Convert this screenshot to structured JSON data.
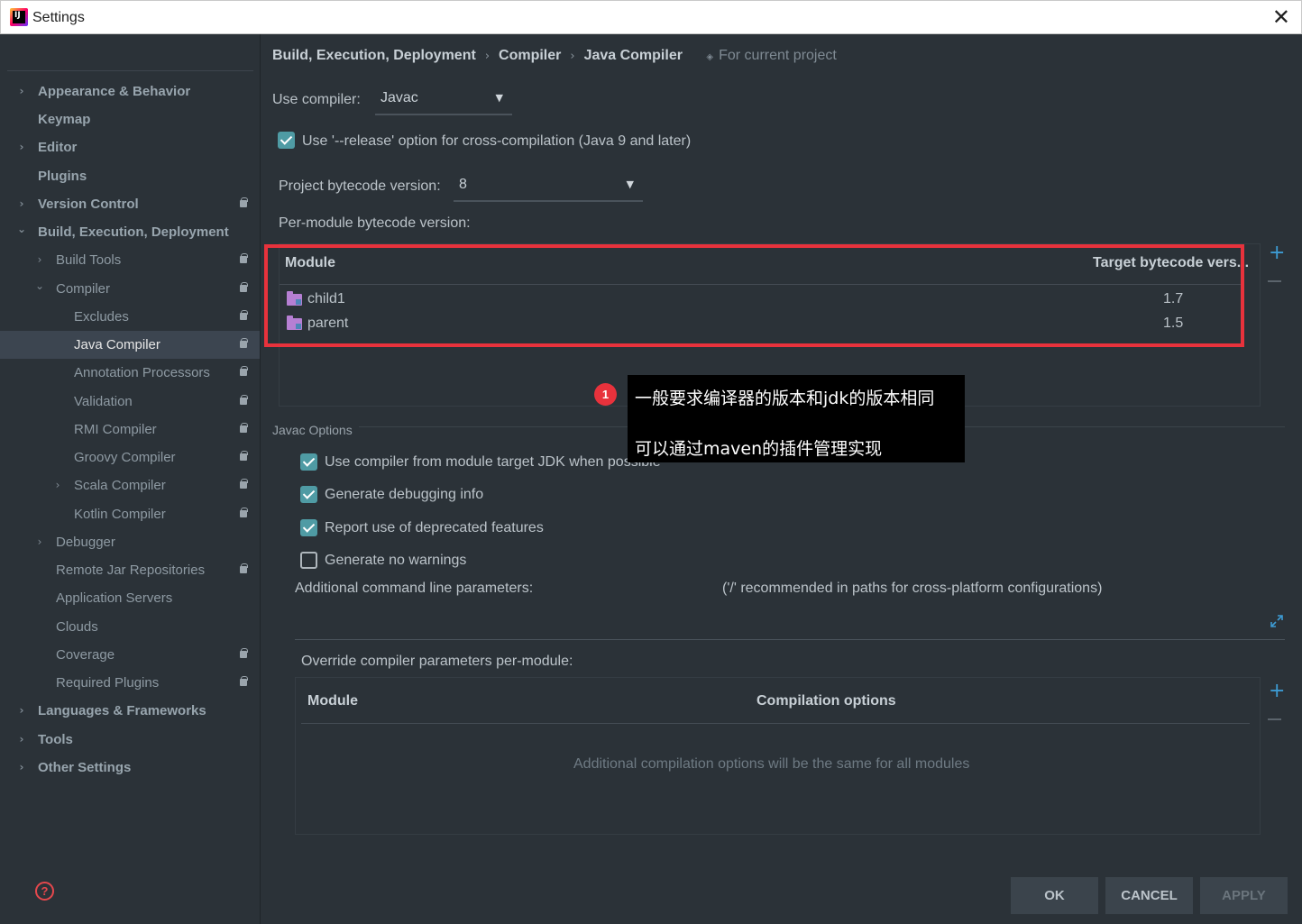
{
  "window": {
    "title": "Settings",
    "close_glyph": "✕",
    "app_icon_text": "IJ",
    "app_icon": "intellij-icon"
  },
  "sidebar": {
    "items": [
      {
        "label": "Appearance & Behavior",
        "arrow": "›"
      },
      {
        "label": "Keymap"
      },
      {
        "label": "Editor",
        "arrow": "›"
      },
      {
        "label": "Plugins"
      },
      {
        "label": "Version Control",
        "arrow": "›"
      },
      {
        "label": "Build, Execution, Deployment",
        "arrow": "⌄"
      },
      {
        "label": "Build Tools",
        "arrow": "›"
      },
      {
        "label": "Compiler",
        "arrow": "⌄"
      },
      {
        "label": "Excludes"
      },
      {
        "label": "Java Compiler"
      },
      {
        "label": "Annotation Processors"
      },
      {
        "label": "Validation"
      },
      {
        "label": "RMI Compiler"
      },
      {
        "label": "Groovy Compiler"
      },
      {
        "label": "Scala Compiler",
        "arrow": "›"
      },
      {
        "label": "Kotlin Compiler"
      },
      {
        "label": "Debugger",
        "arrow": "›"
      },
      {
        "label": "Remote Jar Repositories"
      },
      {
        "label": "Application Servers"
      },
      {
        "label": "Clouds"
      },
      {
        "label": "Coverage"
      },
      {
        "label": "Required Plugins"
      },
      {
        "label": "Languages & Frameworks",
        "arrow": "›"
      },
      {
        "label": "Tools",
        "arrow": "›"
      },
      {
        "label": "Other Settings",
        "arrow": "›"
      }
    ],
    "help_glyph": "?"
  },
  "breadcrumb": {
    "parts": [
      "Build, Execution, Deployment",
      "Compiler",
      "Java Compiler"
    ],
    "separator": "›",
    "scope_icon": "◈",
    "scope": "For current project"
  },
  "compiler": {
    "use_compiler_label": "Use compiler:",
    "use_compiler_value": "Javac",
    "release_option_label": "Use '--release' option for cross-compilation (Java 9 and later)",
    "release_option_checked": true,
    "bytecode_label": "Project bytecode version:",
    "bytecode_value": "8",
    "per_module_label": "Per-module bytecode version:",
    "caret": "▼"
  },
  "module_table": {
    "columns": [
      "Module",
      "Target bytecode vers..."
    ],
    "rows": [
      {
        "module": "child1",
        "target": "1.7"
      },
      {
        "module": "parent",
        "target": "1.5"
      }
    ],
    "add_glyph": "+"
  },
  "annotation": {
    "badge": "1",
    "line1": "一般要求编译器的版本和jdk的版本相同",
    "line2": "可以通过maven的插件管理实现"
  },
  "javac_options": {
    "section_title": "Javac Options",
    "options": [
      {
        "label": "Use compiler from module target JDK when possible",
        "checked": true
      },
      {
        "label": "Generate debugging info",
        "checked": true
      },
      {
        "label": "Report use of deprecated features",
        "checked": true
      },
      {
        "label": "Generate no warnings",
        "checked": false
      }
    ],
    "additional_params_label": "Additional command line parameters:",
    "additional_params_hint": "('/' recommended in paths for cross-platform configurations)",
    "expand_icon": "expand-icon",
    "override_label": "Override compiler parameters per-module:",
    "override_columns": [
      "Module",
      "Compilation options"
    ],
    "override_empty": "Additional compilation options will be the same for all modules",
    "add_glyph": "+"
  },
  "buttons": {
    "ok": "OK",
    "cancel": "CANCEL",
    "apply": "APPLY"
  },
  "colors": {
    "accent": "#3d9bd3",
    "highlight_red": "#e8323c",
    "checkbox": "#4f9ba4",
    "background": "#2b3238"
  }
}
